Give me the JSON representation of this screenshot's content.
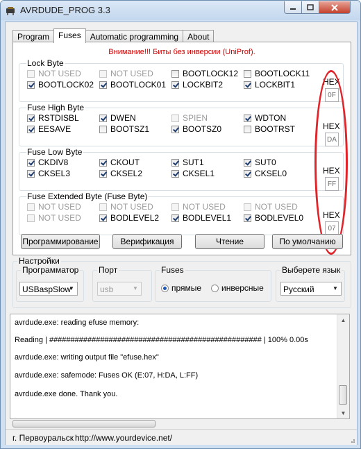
{
  "window": {
    "title": "AVRDUDE_PROG 3.3",
    "controls": {
      "minimize": "–",
      "maximize": "□",
      "close": "✕"
    }
  },
  "tabs": [
    "Program",
    "Fuses",
    "Automatic programming",
    "About"
  ],
  "active_tab": "Fuses",
  "warning": "Внимание!!! Биты без инверсии (UniProf).",
  "hex_caption": "HEX",
  "groups": {
    "lock": {
      "title": "Lock Byte",
      "hex": "0F",
      "bits": [
        {
          "label": "NOT USED",
          "state": "disabled"
        },
        {
          "label": "NOT USED",
          "state": "disabled"
        },
        {
          "label": "BOOTLOCK12",
          "state": "unchecked"
        },
        {
          "label": "BOOTLOCK11",
          "state": "unchecked"
        },
        {
          "label": "BOOTLOCK02",
          "state": "checked"
        },
        {
          "label": "BOOTLOCK01",
          "state": "checked"
        },
        {
          "label": "LOCKBIT2",
          "state": "checked"
        },
        {
          "label": "LOCKBIT1",
          "state": "checked"
        }
      ]
    },
    "high": {
      "title": "Fuse High Byte",
      "hex": "DA",
      "bits": [
        {
          "label": "RSTDISBL",
          "state": "checked"
        },
        {
          "label": "DWEN",
          "state": "checked"
        },
        {
          "label": "SPIEN",
          "state": "disabled"
        },
        {
          "label": "WDTON",
          "state": "checked"
        },
        {
          "label": "EESAVE",
          "state": "checked"
        },
        {
          "label": "BOOTSZ1",
          "state": "unchecked"
        },
        {
          "label": "BOOTSZ0",
          "state": "checked"
        },
        {
          "label": "BOOTRST",
          "state": "unchecked"
        }
      ]
    },
    "low": {
      "title": "Fuse Low Byte",
      "hex": "FF",
      "bits": [
        {
          "label": "CKDIV8",
          "state": "checked"
        },
        {
          "label": "CKOUT",
          "state": "checked"
        },
        {
          "label": "SUT1",
          "state": "checked"
        },
        {
          "label": "SUT0",
          "state": "checked"
        },
        {
          "label": "CKSEL3",
          "state": "checked"
        },
        {
          "label": "CKSEL2",
          "state": "checked"
        },
        {
          "label": "CKSEL1",
          "state": "checked"
        },
        {
          "label": "CKSEL0",
          "state": "checked"
        }
      ]
    },
    "ext": {
      "title": "Fuse Extended Byte (Fuse Byte)",
      "hex": "07",
      "bits": [
        {
          "label": "NOT USED",
          "state": "disabled"
        },
        {
          "label": "NOT USED",
          "state": "disabled"
        },
        {
          "label": "NOT USED",
          "state": "disabled"
        },
        {
          "label": "NOT USED",
          "state": "disabled"
        },
        {
          "label": "NOT USED",
          "state": "disabled"
        },
        {
          "label": "BODLEVEL2",
          "state": "checked"
        },
        {
          "label": "BODLEVEL1",
          "state": "checked"
        },
        {
          "label": "BODLEVEL0",
          "state": "checked"
        }
      ]
    }
  },
  "buttons": {
    "program": "Программирование",
    "verify": "Верификация",
    "read": "Чтение",
    "default": "По умолчанию"
  },
  "settings": {
    "title": "Настройки",
    "programmer": {
      "label": "Программатор",
      "value": "USBaspSlow"
    },
    "port": {
      "label": "Порт",
      "value": "usb"
    },
    "fuses": {
      "label": "Fuses",
      "direct": "прямые",
      "inverse": "инверсные",
      "selected": "прямые"
    },
    "language": {
      "label": "Выберете язык",
      "value": "Русский"
    }
  },
  "log": [
    "avrdude.exe: reading efuse memory:",
    "Reading | ################################################## | 100% 0.00s",
    "avrdude.exe: writing output file \"efuse.hex\"",
    "avrdude.exe: safemode: Fuses OK (E:07, H:DA, L:FF)",
    "avrdude.exe done.  Thank you."
  ],
  "status": {
    "city": "г. Первоуральск",
    "url": "http://www.yourdevice.net/"
  },
  "colors": {
    "warning": "#cc0000",
    "annotation_oval": "#e0242a",
    "close_button": "#c4402c"
  }
}
